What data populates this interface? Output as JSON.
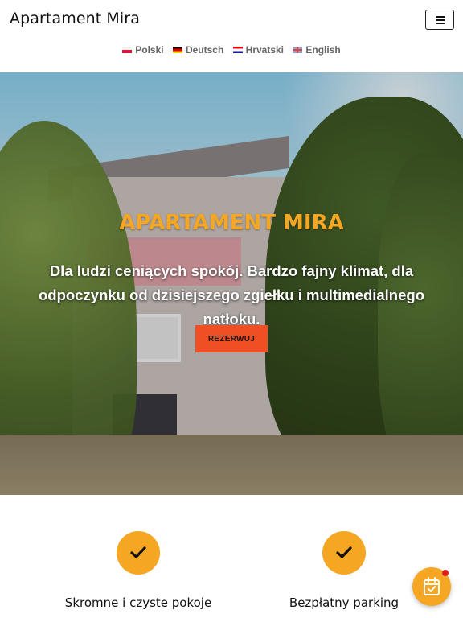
{
  "header": {
    "brand": "Apartament Mira",
    "menu_icon": "hamburger-menu-icon"
  },
  "languages": [
    {
      "label": "Polski",
      "flag": "poland-flag-icon"
    },
    {
      "label": "Deutsch",
      "flag": "germany-flag-icon"
    },
    {
      "label": "Hrvatski",
      "flag": "croatia-flag-icon"
    },
    {
      "label": "English",
      "flag": "uk-flag-icon"
    }
  ],
  "hero": {
    "title": "APARTAMENT MIRA",
    "subtitle": "Dla ludzi ceniących spokój. Bardzo fajny klimat, dla odpoczynku od dzisiejszego zgiełku i multimedialnego natłoku.",
    "cta_label": "REZERWUJ"
  },
  "features": [
    {
      "label": "Skromne i czyste pokoje",
      "icon": "checkmark-icon"
    },
    {
      "label": "Bezpłatny parking",
      "icon": "checkmark-icon"
    }
  ],
  "floating": {
    "icon": "calendar-check-icon"
  },
  "colors": {
    "accent": "#f5a623",
    "cta": "#f04e23",
    "notification_dot": "#e02020"
  }
}
